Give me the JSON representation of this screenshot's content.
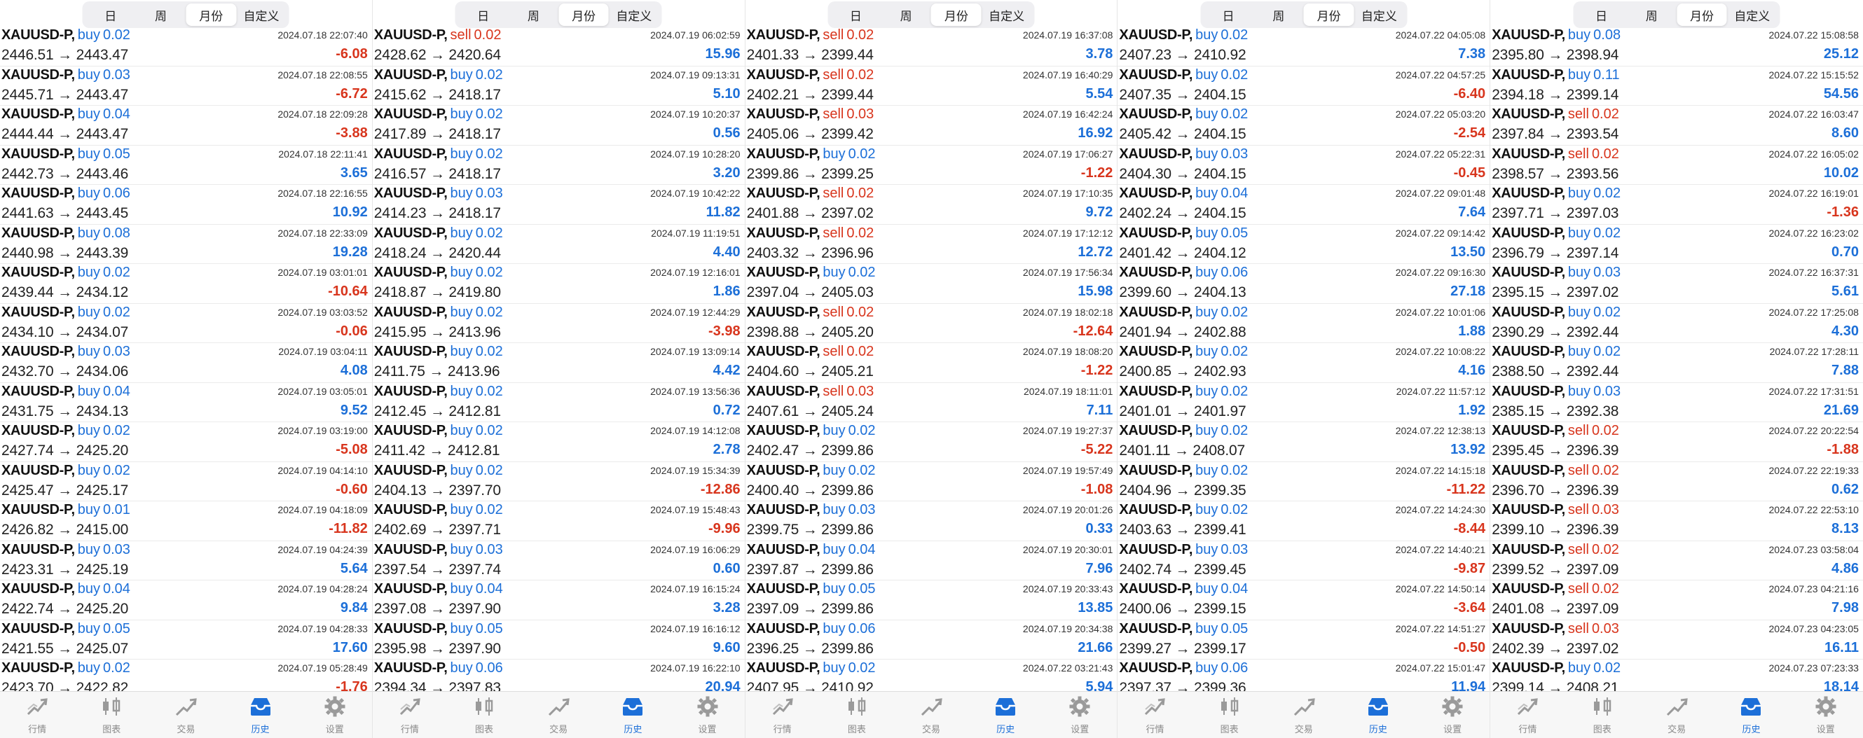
{
  "segments": [
    "日",
    "周",
    "月份",
    "自定义"
  ],
  "active_segment": 2,
  "tabs": [
    {
      "label": "行情",
      "icon": "quotes-icon"
    },
    {
      "label": "图表",
      "icon": "candlestick-chart-icon"
    },
    {
      "label": "交易",
      "icon": "trade-icon"
    },
    {
      "label": "历史",
      "icon": "history-inbox-icon"
    },
    {
      "label": "设置",
      "icon": "settings-gear-icon"
    }
  ],
  "active_tab": 3,
  "colors": {
    "buy": "#1c6fd8",
    "sell": "#d8351d",
    "profit": "#1c6fd8",
    "loss": "#d8351d"
  },
  "panels": [
    {
      "rows": [
        {
          "symbol": "XAUUSD-P,",
          "side": "buy",
          "vol": "0.02",
          "prices": "2446.51 → 2443.47",
          "time": "2024.07.18 22:07:40",
          "pl": "-6.08"
        },
        {
          "symbol": "XAUUSD-P,",
          "side": "buy",
          "vol": "0.03",
          "prices": "2445.71 → 2443.47",
          "time": "2024.07.18 22:08:55",
          "pl": "-6.72"
        },
        {
          "symbol": "XAUUSD-P,",
          "side": "buy",
          "vol": "0.04",
          "prices": "2444.44 → 2443.47",
          "time": "2024.07.18 22:09:28",
          "pl": "-3.88"
        },
        {
          "symbol": "XAUUSD-P,",
          "side": "buy",
          "vol": "0.05",
          "prices": "2442.73 → 2443.46",
          "time": "2024.07.18 22:11:41",
          "pl": "3.65"
        },
        {
          "symbol": "XAUUSD-P,",
          "side": "buy",
          "vol": "0.06",
          "prices": "2441.63 → 2443.45",
          "time": "2024.07.18 22:16:55",
          "pl": "10.92"
        },
        {
          "symbol": "XAUUSD-P,",
          "side": "buy",
          "vol": "0.08",
          "prices": "2440.98 → 2443.39",
          "time": "2024.07.18 22:33:09",
          "pl": "19.28"
        },
        {
          "symbol": "XAUUSD-P,",
          "side": "buy",
          "vol": "0.02",
          "prices": "2439.44 → 2434.12",
          "time": "2024.07.19 03:01:01",
          "pl": "-10.64"
        },
        {
          "symbol": "XAUUSD-P,",
          "side": "buy",
          "vol": "0.02",
          "prices": "2434.10 → 2434.07",
          "time": "2024.07.19 03:03:52",
          "pl": "-0.06"
        },
        {
          "symbol": "XAUUSD-P,",
          "side": "buy",
          "vol": "0.03",
          "prices": "2432.70 → 2434.06",
          "time": "2024.07.19 03:04:11",
          "pl": "4.08"
        },
        {
          "symbol": "XAUUSD-P,",
          "side": "buy",
          "vol": "0.04",
          "prices": "2431.75 → 2434.13",
          "time": "2024.07.19 03:05:01",
          "pl": "9.52"
        },
        {
          "symbol": "XAUUSD-P,",
          "side": "buy",
          "vol": "0.02",
          "prices": "2427.74 → 2425.20",
          "time": "2024.07.19 03:19:00",
          "pl": "-5.08"
        },
        {
          "symbol": "XAUUSD-P,",
          "side": "buy",
          "vol": "0.02",
          "prices": "2425.47 → 2425.17",
          "time": "2024.07.19 04:14:10",
          "pl": "-0.60"
        },
        {
          "symbol": "XAUUSD-P,",
          "side": "buy",
          "vol": "0.01",
          "prices": "2426.82 → 2415.00",
          "time": "2024.07.19 04:18:09",
          "pl": "-11.82"
        },
        {
          "symbol": "XAUUSD-P,",
          "side": "buy",
          "vol": "0.03",
          "prices": "2423.31 → 2425.19",
          "time": "2024.07.19 04:24:39",
          "pl": "5.64"
        },
        {
          "symbol": "XAUUSD-P,",
          "side": "buy",
          "vol": "0.04",
          "prices": "2422.74 → 2425.20",
          "time": "2024.07.19 04:28:24",
          "pl": "9.84"
        },
        {
          "symbol": "XAUUSD-P,",
          "side": "buy",
          "vol": "0.05",
          "prices": "2421.55 → 2425.07",
          "time": "2024.07.19 04:28:33",
          "pl": "17.60"
        },
        {
          "symbol": "XAUUSD-P,",
          "side": "buy",
          "vol": "0.02",
          "prices": "2423.70 → 2422.82",
          "time": "2024.07.19 05:28:49",
          "pl": "-1.76"
        }
      ]
    },
    {
      "rows": [
        {
          "symbol": "XAUUSD-P,",
          "side": "sell",
          "vol": "0.02",
          "prices": "2428.62 → 2420.64",
          "time": "2024.07.19 06:02:59",
          "pl": "15.96"
        },
        {
          "symbol": "XAUUSD-P,",
          "side": "buy",
          "vol": "0.02",
          "prices": "2415.62 → 2418.17",
          "time": "2024.07.19 09:13:31",
          "pl": "5.10"
        },
        {
          "symbol": "XAUUSD-P,",
          "side": "buy",
          "vol": "0.02",
          "prices": "2417.89 → 2418.17",
          "time": "2024.07.19 10:20:37",
          "pl": "0.56"
        },
        {
          "symbol": "XAUUSD-P,",
          "side": "buy",
          "vol": "0.02",
          "prices": "2416.57 → 2418.17",
          "time": "2024.07.19 10:28:20",
          "pl": "3.20"
        },
        {
          "symbol": "XAUUSD-P,",
          "side": "buy",
          "vol": "0.03",
          "prices": "2414.23 → 2418.17",
          "time": "2024.07.19 10:42:22",
          "pl": "11.82"
        },
        {
          "symbol": "XAUUSD-P,",
          "side": "buy",
          "vol": "0.02",
          "prices": "2418.24 → 2420.44",
          "time": "2024.07.19 11:19:51",
          "pl": "4.40"
        },
        {
          "symbol": "XAUUSD-P,",
          "side": "buy",
          "vol": "0.02",
          "prices": "2418.87 → 2419.80",
          "time": "2024.07.19 12:16:01",
          "pl": "1.86"
        },
        {
          "symbol": "XAUUSD-P,",
          "side": "buy",
          "vol": "0.02",
          "prices": "2415.95 → 2413.96",
          "time": "2024.07.19 12:44:29",
          "pl": "-3.98"
        },
        {
          "symbol": "XAUUSD-P,",
          "side": "buy",
          "vol": "0.02",
          "prices": "2411.75 → 2413.96",
          "time": "2024.07.19 13:09:14",
          "pl": "4.42"
        },
        {
          "symbol": "XAUUSD-P,",
          "side": "buy",
          "vol": "0.02",
          "prices": "2412.45 → 2412.81",
          "time": "2024.07.19 13:56:36",
          "pl": "0.72"
        },
        {
          "symbol": "XAUUSD-P,",
          "side": "buy",
          "vol": "0.02",
          "prices": "2411.42 → 2412.81",
          "time": "2024.07.19 14:12:08",
          "pl": "2.78"
        },
        {
          "symbol": "XAUUSD-P,",
          "side": "buy",
          "vol": "0.02",
          "prices": "2404.13 → 2397.70",
          "time": "2024.07.19 15:34:39",
          "pl": "-12.86"
        },
        {
          "symbol": "XAUUSD-P,",
          "side": "buy",
          "vol": "0.02",
          "prices": "2402.69 → 2397.71",
          "time": "2024.07.19 15:48:43",
          "pl": "-9.96"
        },
        {
          "symbol": "XAUUSD-P,",
          "side": "buy",
          "vol": "0.03",
          "prices": "2397.54 → 2397.74",
          "time": "2024.07.19 16:06:29",
          "pl": "0.60"
        },
        {
          "symbol": "XAUUSD-P,",
          "side": "buy",
          "vol": "0.04",
          "prices": "2397.08 → 2397.90",
          "time": "2024.07.19 16:15:24",
          "pl": "3.28"
        },
        {
          "symbol": "XAUUSD-P,",
          "side": "buy",
          "vol": "0.05",
          "prices": "2395.98 → 2397.90",
          "time": "2024.07.19 16:16:12",
          "pl": "9.60"
        },
        {
          "symbol": "XAUUSD-P,",
          "side": "buy",
          "vol": "0.06",
          "prices": "2394.34 → 2397.83",
          "time": "2024.07.19 16:22:10",
          "pl": "20.94"
        }
      ]
    },
    {
      "rows": [
        {
          "symbol": "XAUUSD-P,",
          "side": "sell",
          "vol": "0.02",
          "prices": "2401.33 → 2399.44",
          "time": "2024.07.19 16:37:08",
          "pl": "3.78"
        },
        {
          "symbol": "XAUUSD-P,",
          "side": "sell",
          "vol": "0.02",
          "prices": "2402.21 → 2399.44",
          "time": "2024.07.19 16:40:29",
          "pl": "5.54"
        },
        {
          "symbol": "XAUUSD-P,",
          "side": "sell",
          "vol": "0.03",
          "prices": "2405.06 → 2399.42",
          "time": "2024.07.19 16:42:24",
          "pl": "16.92"
        },
        {
          "symbol": "XAUUSD-P,",
          "side": "buy",
          "vol": "0.02",
          "prices": "2399.86 → 2399.25",
          "time": "2024.07.19 17:06:27",
          "pl": "-1.22"
        },
        {
          "symbol": "XAUUSD-P,",
          "side": "sell",
          "vol": "0.02",
          "prices": "2401.88 → 2397.02",
          "time": "2024.07.19 17:10:35",
          "pl": "9.72"
        },
        {
          "symbol": "XAUUSD-P,",
          "side": "sell",
          "vol": "0.02",
          "prices": "2403.32 → 2396.96",
          "time": "2024.07.19 17:12:12",
          "pl": "12.72"
        },
        {
          "symbol": "XAUUSD-P,",
          "side": "buy",
          "vol": "0.02",
          "prices": "2397.04 → 2405.03",
          "time": "2024.07.19 17:56:34",
          "pl": "15.98"
        },
        {
          "symbol": "XAUUSD-P,",
          "side": "sell",
          "vol": "0.02",
          "prices": "2398.88 → 2405.20",
          "time": "2024.07.19 18:02:18",
          "pl": "-12.64"
        },
        {
          "symbol": "XAUUSD-P,",
          "side": "sell",
          "vol": "0.02",
          "prices": "2404.60 → 2405.21",
          "time": "2024.07.19 18:08:20",
          "pl": "-1.22"
        },
        {
          "symbol": "XAUUSD-P,",
          "side": "sell",
          "vol": "0.03",
          "prices": "2407.61 → 2405.24",
          "time": "2024.07.19 18:11:01",
          "pl": "7.11"
        },
        {
          "symbol": "XAUUSD-P,",
          "side": "buy",
          "vol": "0.02",
          "prices": "2402.47 → 2399.86",
          "time": "2024.07.19 19:27:37",
          "pl": "-5.22"
        },
        {
          "symbol": "XAUUSD-P,",
          "side": "buy",
          "vol": "0.02",
          "prices": "2400.40 → 2399.86",
          "time": "2024.07.19 19:57:49",
          "pl": "-1.08"
        },
        {
          "symbol": "XAUUSD-P,",
          "side": "buy",
          "vol": "0.03",
          "prices": "2399.75 → 2399.86",
          "time": "2024.07.19 20:01:26",
          "pl": "0.33"
        },
        {
          "symbol": "XAUUSD-P,",
          "side": "buy",
          "vol": "0.04",
          "prices": "2397.87 → 2399.86",
          "time": "2024.07.19 20:30:01",
          "pl": "7.96"
        },
        {
          "symbol": "XAUUSD-P,",
          "side": "buy",
          "vol": "0.05",
          "prices": "2397.09 → 2399.86",
          "time": "2024.07.19 20:33:43",
          "pl": "13.85"
        },
        {
          "symbol": "XAUUSD-P,",
          "side": "buy",
          "vol": "0.06",
          "prices": "2396.25 → 2399.86",
          "time": "2024.07.19 20:34:38",
          "pl": "21.66"
        },
        {
          "symbol": "XAUUSD-P,",
          "side": "buy",
          "vol": "0.02",
          "prices": "2407.95 → 2410.92",
          "time": "2024.07.22 03:21:43",
          "pl": "5.94"
        }
      ]
    },
    {
      "rows": [
        {
          "symbol": "XAUUSD-P,",
          "side": "buy",
          "vol": "0.02",
          "prices": "2407.23 → 2410.92",
          "time": "2024.07.22 04:05:08",
          "pl": "7.38"
        },
        {
          "symbol": "XAUUSD-P,",
          "side": "buy",
          "vol": "0.02",
          "prices": "2407.35 → 2404.15",
          "time": "2024.07.22 04:57:25",
          "pl": "-6.40"
        },
        {
          "symbol": "XAUUSD-P,",
          "side": "buy",
          "vol": "0.02",
          "prices": "2405.42 → 2404.15",
          "time": "2024.07.22 05:03:20",
          "pl": "-2.54"
        },
        {
          "symbol": "XAUUSD-P,",
          "side": "buy",
          "vol": "0.03",
          "prices": "2404.30 → 2404.15",
          "time": "2024.07.22 05:22:31",
          "pl": "-0.45"
        },
        {
          "symbol": "XAUUSD-P,",
          "side": "buy",
          "vol": "0.04",
          "prices": "2402.24 → 2404.15",
          "time": "2024.07.22 09:01:48",
          "pl": "7.64"
        },
        {
          "symbol": "XAUUSD-P,",
          "side": "buy",
          "vol": "0.05",
          "prices": "2401.42 → 2404.12",
          "time": "2024.07.22 09:14:42",
          "pl": "13.50"
        },
        {
          "symbol": "XAUUSD-P,",
          "side": "buy",
          "vol": "0.06",
          "prices": "2399.60 → 2404.13",
          "time": "2024.07.22 09:16:30",
          "pl": "27.18"
        },
        {
          "symbol": "XAUUSD-P,",
          "side": "buy",
          "vol": "0.02",
          "prices": "2401.94 → 2402.88",
          "time": "2024.07.22 10:01:06",
          "pl": "1.88"
        },
        {
          "symbol": "XAUUSD-P,",
          "side": "buy",
          "vol": "0.02",
          "prices": "2400.85 → 2402.93",
          "time": "2024.07.22 10:08:22",
          "pl": "4.16"
        },
        {
          "symbol": "XAUUSD-P,",
          "side": "buy",
          "vol": "0.02",
          "prices": "2401.01 → 2401.97",
          "time": "2024.07.22 11:57:12",
          "pl": "1.92"
        },
        {
          "symbol": "XAUUSD-P,",
          "side": "buy",
          "vol": "0.02",
          "prices": "2401.11 → 2408.07",
          "time": "2024.07.22 12:38:13",
          "pl": "13.92"
        },
        {
          "symbol": "XAUUSD-P,",
          "side": "buy",
          "vol": "0.02",
          "prices": "2404.96 → 2399.35",
          "time": "2024.07.22 14:15:18",
          "pl": "-11.22"
        },
        {
          "symbol": "XAUUSD-P,",
          "side": "buy",
          "vol": "0.02",
          "prices": "2403.63 → 2399.41",
          "time": "2024.07.22 14:24:30",
          "pl": "-8.44"
        },
        {
          "symbol": "XAUUSD-P,",
          "side": "buy",
          "vol": "0.03",
          "prices": "2402.74 → 2399.45",
          "time": "2024.07.22 14:40:21",
          "pl": "-9.87"
        },
        {
          "symbol": "XAUUSD-P,",
          "side": "buy",
          "vol": "0.04",
          "prices": "2400.06 → 2399.15",
          "time": "2024.07.22 14:50:14",
          "pl": "-3.64"
        },
        {
          "symbol": "XAUUSD-P,",
          "side": "buy",
          "vol": "0.05",
          "prices": "2399.27 → 2399.17",
          "time": "2024.07.22 14:51:27",
          "pl": "-0.50"
        },
        {
          "symbol": "XAUUSD-P,",
          "side": "buy",
          "vol": "0.06",
          "prices": "2397.37 → 2399.36",
          "time": "2024.07.22 15:01:47",
          "pl": "11.94"
        }
      ]
    },
    {
      "rows": [
        {
          "symbol": "XAUUSD-P,",
          "side": "buy",
          "vol": "0.08",
          "prices": "2395.80 → 2398.94",
          "time": "2024.07.22 15:08:58",
          "pl": "25.12"
        },
        {
          "symbol": "XAUUSD-P,",
          "side": "buy",
          "vol": "0.11",
          "prices": "2394.18 → 2399.14",
          "time": "2024.07.22 15:15:52",
          "pl": "54.56"
        },
        {
          "symbol": "XAUUSD-P,",
          "side": "sell",
          "vol": "0.02",
          "prices": "2397.84 → 2393.54",
          "time": "2024.07.22 16:03:47",
          "pl": "8.60"
        },
        {
          "symbol": "XAUUSD-P,",
          "side": "sell",
          "vol": "0.02",
          "prices": "2398.57 → 2393.56",
          "time": "2024.07.22 16:05:02",
          "pl": "10.02"
        },
        {
          "symbol": "XAUUSD-P,",
          "side": "buy",
          "vol": "0.02",
          "prices": "2397.71 → 2397.03",
          "time": "2024.07.22 16:19:01",
          "pl": "-1.36"
        },
        {
          "symbol": "XAUUSD-P,",
          "side": "buy",
          "vol": "0.02",
          "prices": "2396.79 → 2397.14",
          "time": "2024.07.22 16:23:02",
          "pl": "0.70"
        },
        {
          "symbol": "XAUUSD-P,",
          "side": "buy",
          "vol": "0.03",
          "prices": "2395.15 → 2397.02",
          "time": "2024.07.22 16:37:31",
          "pl": "5.61"
        },
        {
          "symbol": "XAUUSD-P,",
          "side": "buy",
          "vol": "0.02",
          "prices": "2390.29 → 2392.44",
          "time": "2024.07.22 17:25:08",
          "pl": "4.30"
        },
        {
          "symbol": "XAUUSD-P,",
          "side": "buy",
          "vol": "0.02",
          "prices": "2388.50 → 2392.44",
          "time": "2024.07.22 17:28:11",
          "pl": "7.88"
        },
        {
          "symbol": "XAUUSD-P,",
          "side": "buy",
          "vol": "0.03",
          "prices": "2385.15 → 2392.38",
          "time": "2024.07.22 17:31:51",
          "pl": "21.69"
        },
        {
          "symbol": "XAUUSD-P,",
          "side": "sell",
          "vol": "0.02",
          "prices": "2395.45 → 2396.39",
          "time": "2024.07.22 20:22:54",
          "pl": "-1.88"
        },
        {
          "symbol": "XAUUSD-P,",
          "side": "sell",
          "vol": "0.02",
          "prices": "2396.70 → 2396.39",
          "time": "2024.07.22 22:19:33",
          "pl": "0.62"
        },
        {
          "symbol": "XAUUSD-P,",
          "side": "sell",
          "vol": "0.03",
          "prices": "2399.10 → 2396.39",
          "time": "2024.07.22 22:53:10",
          "pl": "8.13"
        },
        {
          "symbol": "XAUUSD-P,",
          "side": "sell",
          "vol": "0.02",
          "prices": "2399.52 → 2397.09",
          "time": "2024.07.23 03:58:04",
          "pl": "4.86"
        },
        {
          "symbol": "XAUUSD-P,",
          "side": "sell",
          "vol": "0.02",
          "prices": "2401.08 → 2397.09",
          "time": "2024.07.23 04:21:16",
          "pl": "7.98"
        },
        {
          "symbol": "XAUUSD-P,",
          "side": "sell",
          "vol": "0.03",
          "prices": "2402.39 → 2397.02",
          "time": "2024.07.23 04:23:05",
          "pl": "16.11"
        },
        {
          "symbol": "XAUUSD-P,",
          "side": "buy",
          "vol": "0.02",
          "prices": "2399.14 → 2408.21",
          "time": "2024.07.23 07:23:33",
          "pl": "18.14"
        }
      ]
    }
  ]
}
